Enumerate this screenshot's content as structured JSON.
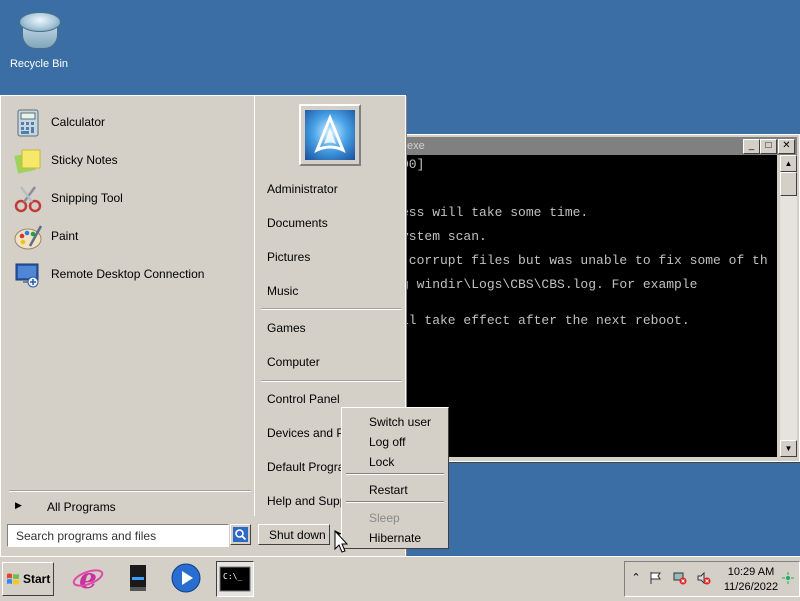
{
  "desktop": {
    "recycle_bin_label": "Recycle Bin"
  },
  "console": {
    "title": "exe",
    "lines": [
      "00]",
      "",
      "ess will take some time.",
      "ystem scan.",
      " corrupt files but was unable to fix some of th",
      "g windir\\Logs\\CBS\\CBS.log. For example",
      "ll take effect after the next reboot."
    ]
  },
  "start_menu": {
    "programs": [
      {
        "label": "Calculator",
        "icon": "calculator-icon"
      },
      {
        "label": "Sticky Notes",
        "icon": "sticky-notes-icon"
      },
      {
        "label": "Snipping Tool",
        "icon": "scissors-icon"
      },
      {
        "label": "Paint",
        "icon": "paint-palette-icon"
      },
      {
        "label": "Remote Desktop Connection",
        "icon": "remote-desktop-icon"
      }
    ],
    "all_programs": "All Programs",
    "search_placeholder": "Search programs and files",
    "right": {
      "items": [
        "Administrator",
        "Documents",
        "Pictures",
        "Music",
        "Games",
        "Computer",
        "Control Panel",
        "Devices and Pri",
        "Default Program",
        "Help and Suppo"
      ]
    },
    "shutdown_label": "Shut down"
  },
  "power_menu": {
    "items": [
      "Switch user",
      "Log off",
      "Lock",
      "Restart",
      "Sleep",
      "Hibernate"
    ],
    "disabled": "Sleep"
  },
  "taskbar": {
    "start_label": "Start",
    "clock_time": "10:29 AM",
    "clock_date": "11/26/2022"
  },
  "colors": {
    "desktop": "#3b6ea5",
    "chrome": "#d4d0c8",
    "console_bg": "#000000",
    "console_fg": "#c0c0c0"
  }
}
